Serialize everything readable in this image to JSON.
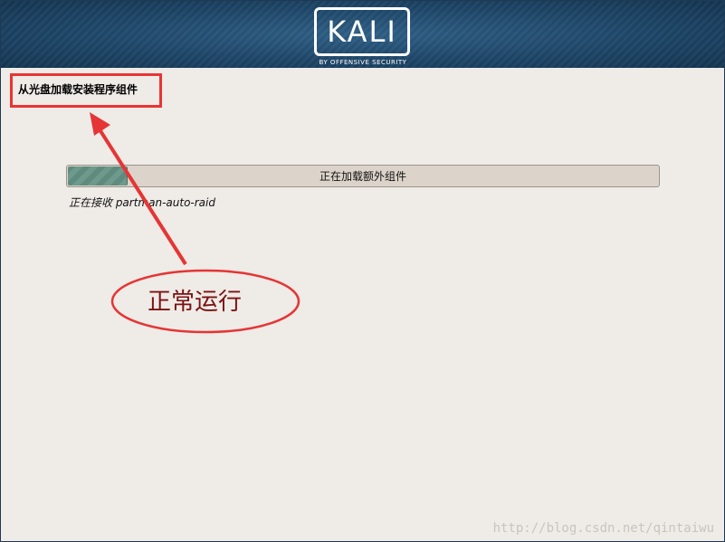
{
  "banner": {
    "logo_text": "KALI",
    "logo_subtitle": "BY OFFENSIVE SECURITY"
  },
  "page": {
    "title": "从光盘加载安装程序组件"
  },
  "progress": {
    "label": "正在加载额外组件",
    "fraction": 0.1
  },
  "status": {
    "text": "正在接收 partman-auto-raid"
  },
  "annotation": {
    "text": "正常运行",
    "arrow_color": "#e53535",
    "ellipse_color": "#e53535"
  },
  "watermark": {
    "text": "http://blog.csdn.net/qintaiwu"
  }
}
